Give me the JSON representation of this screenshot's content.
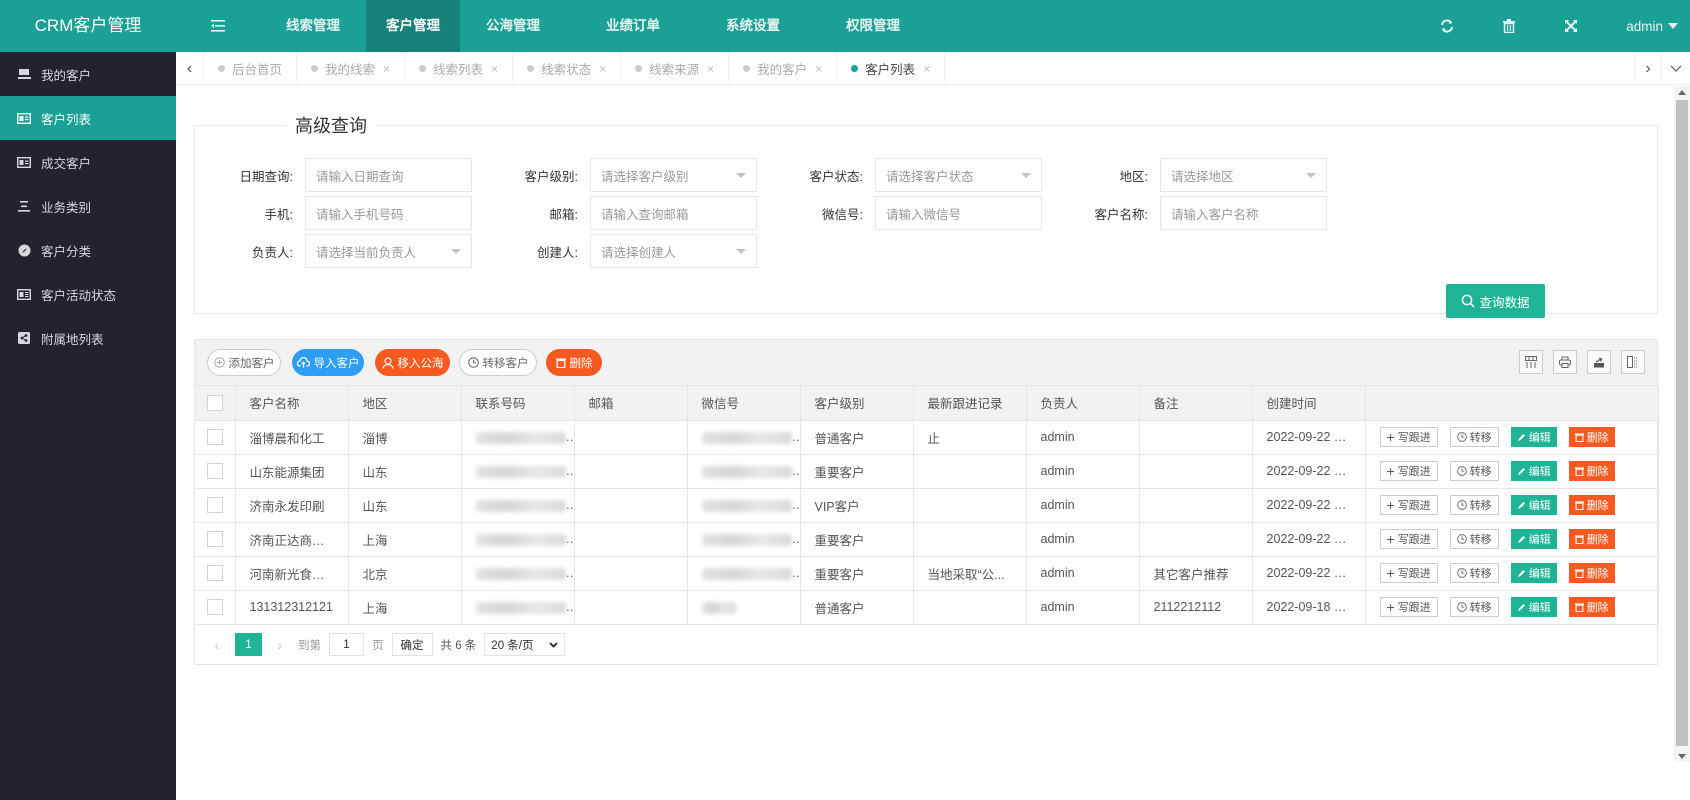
{
  "app": {
    "title": "CRM客户管理",
    "accent": "#1aa094",
    "sidebar_bg": "#23232d"
  },
  "topnav": {
    "items": [
      {
        "label": "线索管理",
        "active": false
      },
      {
        "label": "客户管理",
        "active": true
      },
      {
        "label": "公海管理",
        "active": false
      },
      {
        "label": "业绩订单",
        "active": false
      },
      {
        "label": "系统设置",
        "active": false
      },
      {
        "label": "权限管理",
        "active": false
      }
    ],
    "icons": [
      "refresh-icon",
      "trash-icon",
      "fullscreen-icon"
    ],
    "user": "admin"
  },
  "sidebar": {
    "items": [
      {
        "label": "我的客户",
        "icon": "cup-icon",
        "active": false
      },
      {
        "label": "客户列表",
        "icon": "id-card-icon",
        "active": true
      },
      {
        "label": "成交客户",
        "icon": "id-card-icon",
        "active": false
      },
      {
        "label": "业务类别",
        "icon": "list-icon",
        "active": false
      },
      {
        "label": "客户分类",
        "icon": "compass-icon",
        "active": false
      },
      {
        "label": "客户活动状态",
        "icon": "newspaper-icon",
        "active": false
      },
      {
        "label": "附属地列表",
        "icon": "share-icon",
        "active": false
      }
    ]
  },
  "tabs": [
    {
      "label": "后台首页",
      "closable": false,
      "active": false
    },
    {
      "label": "我的线索",
      "closable": true,
      "active": false
    },
    {
      "label": "线索列表",
      "closable": true,
      "active": false
    },
    {
      "label": "线索状态",
      "closable": true,
      "active": false
    },
    {
      "label": "线索来源",
      "closable": true,
      "active": false
    },
    {
      "label": "我的客户",
      "closable": true,
      "active": false
    },
    {
      "label": "客户列表",
      "closable": true,
      "active": true
    }
  ],
  "search": {
    "legend": "高级查询",
    "fields": {
      "date": {
        "label": "日期查询:",
        "placeholder": "请输入日期查询"
      },
      "level": {
        "label": "客户级别:",
        "placeholder": "请选择客户级别"
      },
      "status": {
        "label": "客户状态:",
        "placeholder": "请选择客户状态"
      },
      "region": {
        "label": "地区:",
        "placeholder": "请选择地区"
      },
      "phone": {
        "label": "手机:",
        "placeholder": "请输入手机号码"
      },
      "email": {
        "label": "邮箱:",
        "placeholder": "请输入查询邮箱"
      },
      "wechat": {
        "label": "微信号:",
        "placeholder": "请输入微信号"
      },
      "name": {
        "label": "客户名称:",
        "placeholder": "请输入客户名称"
      },
      "owner": {
        "label": "负责人:",
        "placeholder": "请选择当前负责人"
      },
      "creator": {
        "label": "创建人:",
        "placeholder": "请选择创建人"
      }
    },
    "submit": "查询数据"
  },
  "toolbar": {
    "add": "添加客户",
    "import": "导入客户",
    "to_pool": "移入公海",
    "transfer": "转移客户",
    "delete": "删除",
    "right_icons": [
      "columns-icon",
      "print-icon",
      "export-icon",
      "layout-icon"
    ]
  },
  "table": {
    "columns": [
      "客户名称",
      "地区",
      "联系号码",
      "邮箱",
      "微信号",
      "客户级别",
      "最新跟进记录",
      "负责人",
      "备注",
      "创建时间",
      ""
    ],
    "rows": [
      {
        "name": "淄博晨和化工",
        "region": "淄博",
        "phone": "[blurred]",
        "email": "",
        "wechat": "[blurred]",
        "level": "普通客户",
        "latest": "止",
        "owner": "admin",
        "remark": "",
        "created": "2022-09-22 1..."
      },
      {
        "name": "山东能源集团",
        "region": "山东",
        "phone": "[blurred]",
        "email": "",
        "wechat": "[blurred]",
        "level": "重要客户",
        "latest": "",
        "owner": "admin",
        "remark": "",
        "created": "2022-09-22 1..."
      },
      {
        "name": "济南永发印刷",
        "region": "山东",
        "phone": "[blurred]",
        "email": "",
        "wechat": "[blurred]",
        "level": "VIP客户",
        "latest": "",
        "owner": "admin",
        "remark": "",
        "created": "2022-09-22 1..."
      },
      {
        "name": "济南正达商贸...",
        "region": "上海",
        "phone": "[blurred]",
        "email": "",
        "wechat": "[blurred]",
        "level": "重要客户",
        "latest": "",
        "owner": "admin",
        "remark": "",
        "created": "2022-09-22 1..."
      },
      {
        "name": "河南新光食品...",
        "region": "北京",
        "phone": "[blurred]",
        "email": "",
        "wechat": "[blurred]",
        "level": "重要客户",
        "latest": "当地采取“公...",
        "owner": "admin",
        "remark": "其它客户推荐",
        "created": "2022-09-22 1..."
      },
      {
        "name": "131312312121",
        "region": "上海",
        "phone": "[blurred]",
        "email": "",
        "wechat": "[blurred-short]",
        "level": "普通客户",
        "latest": "",
        "owner": "admin",
        "remark": "2112212112",
        "created": "2022-09-18 1..."
      }
    ],
    "row_actions": {
      "follow": "写跟进",
      "transfer": "转移",
      "edit": "编辑",
      "delete": "删除"
    }
  },
  "pager": {
    "current": "1",
    "goto_label": "到第",
    "goto_value": "1",
    "page_suffix": "页",
    "confirm": "确定",
    "total": "共 6 条",
    "page_size": "20 条/页"
  }
}
